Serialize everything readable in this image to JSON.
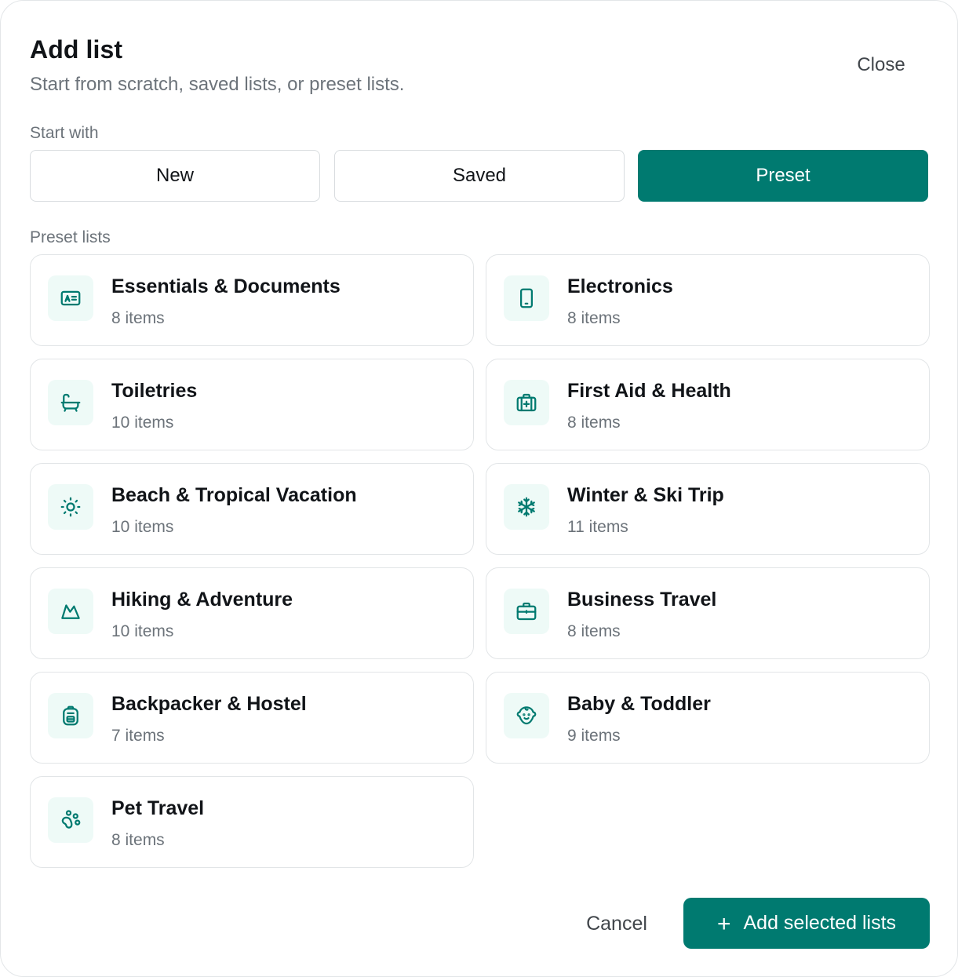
{
  "dialog": {
    "title": "Add list",
    "subtitle": "Start from scratch, saved lists, or preset lists.",
    "close_label": "Close"
  },
  "start_with": {
    "label": "Start with",
    "options": [
      {
        "label": "New",
        "selected": false
      },
      {
        "label": "Saved",
        "selected": false
      },
      {
        "label": "Preset",
        "selected": true
      }
    ]
  },
  "preset_lists": {
    "label": "Preset lists",
    "items": [
      {
        "name": "Essentials & Documents",
        "count": "8 items",
        "icon": "id-card-icon"
      },
      {
        "name": "Electronics",
        "count": "8 items",
        "icon": "tablet-icon"
      },
      {
        "name": "Toiletries",
        "count": "10 items",
        "icon": "bathtub-icon"
      },
      {
        "name": "First Aid & Health",
        "count": "8 items",
        "icon": "first-aid-kit-icon"
      },
      {
        "name": "Beach & Tropical Vacation",
        "count": "10 items",
        "icon": "sun-icon"
      },
      {
        "name": "Winter & Ski Trip",
        "count": "11 items",
        "icon": "snowflake-icon"
      },
      {
        "name": "Hiking & Adventure",
        "count": "10 items",
        "icon": "mountain-icon"
      },
      {
        "name": "Business Travel",
        "count": "8 items",
        "icon": "briefcase-icon"
      },
      {
        "name": "Backpacker & Hostel",
        "count": "7 items",
        "icon": "backpack-icon"
      },
      {
        "name": "Baby & Toddler",
        "count": "9 items",
        "icon": "baby-face-icon"
      },
      {
        "name": "Pet Travel",
        "count": "8 items",
        "icon": "paw-icon"
      }
    ]
  },
  "footer": {
    "cancel_label": "Cancel",
    "add_label": "Add selected lists",
    "add_icon": "plus-icon"
  },
  "colors": {
    "accent": "#007a70",
    "icon_bg": "#eefaf7",
    "muted_text": "#6c737a",
    "border": "#e2e5e7"
  }
}
